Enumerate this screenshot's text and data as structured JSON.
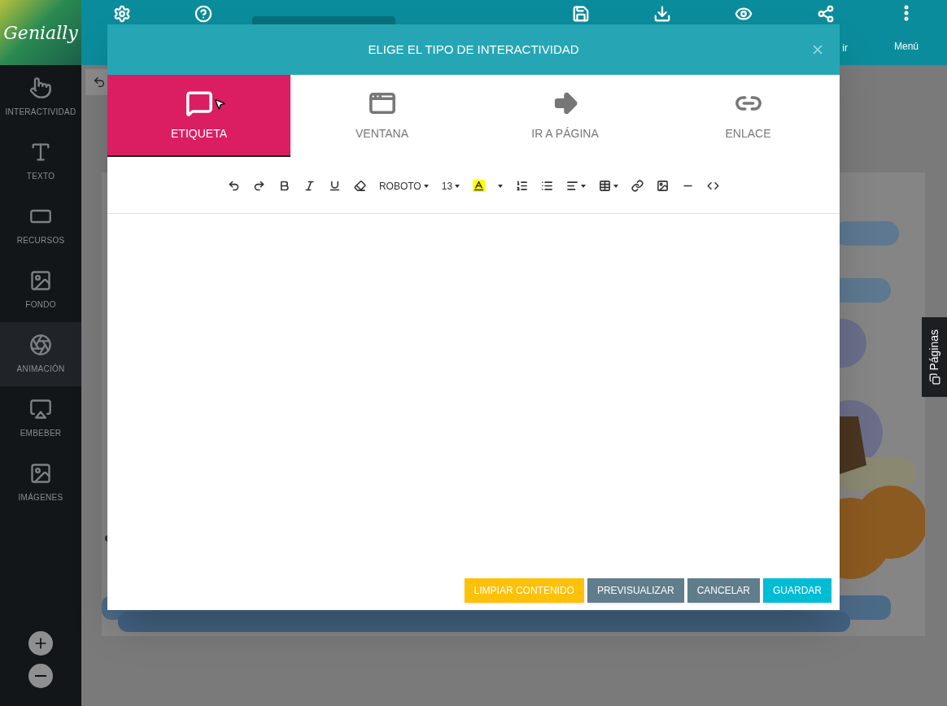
{
  "logo": {
    "text": "Genially"
  },
  "top_bar": {
    "share": {
      "label": "ir"
    },
    "menu": {
      "label": "Menú"
    }
  },
  "sidebar": {
    "items": [
      {
        "label": "INTERACTIVIDAD",
        "selected": false
      },
      {
        "label": "TEXTO",
        "selected": false
      },
      {
        "label": "RECURSOS",
        "selected": false
      },
      {
        "label": "FONDO",
        "selected": false
      },
      {
        "label": "ANIMACIÓN",
        "selected": true
      },
      {
        "label": "EMBEBER",
        "selected": false
      },
      {
        "label": "IMÁGENES",
        "selected": false
      }
    ]
  },
  "pages_tab": {
    "label": "Páginas"
  },
  "modal": {
    "title": "ELIGE EL TIPO DE INTERACTIVIDAD",
    "tabs": [
      {
        "label": "ETIQUETA",
        "selected": true
      },
      {
        "label": "VENTANA",
        "selected": false
      },
      {
        "label": "IR A PÁGINA",
        "selected": false
      },
      {
        "label": "ENLACE",
        "selected": false
      }
    ],
    "editor_toolbar": {
      "font": "ROBOTO",
      "size": "13"
    },
    "buttons": [
      {
        "label": "LIMPIAR CONTENIDO",
        "kind": "warning"
      },
      {
        "label": "PREVISUALIZAR",
        "kind": "secondary"
      },
      {
        "label": "CANCELAR",
        "kind": "secondary"
      },
      {
        "label": "GUARDAR",
        "kind": "primary"
      }
    ]
  }
}
